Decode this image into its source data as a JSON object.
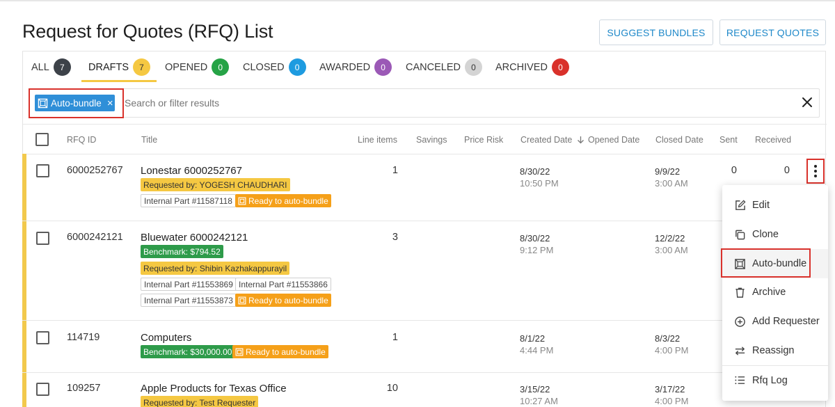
{
  "page": {
    "title": "Request for Quotes (RFQ) List"
  },
  "header": {
    "suggest_label": "SUGGEST BUNDLES",
    "request_label": "REQUEST QUOTES"
  },
  "tabs": [
    {
      "label": "ALL",
      "count": "7",
      "color": "#3d4249"
    },
    {
      "label": "DRAFTS",
      "count": "7",
      "color": "#f5c842"
    },
    {
      "label": "OPENED",
      "count": "0",
      "color": "#26a346"
    },
    {
      "label": "CLOSED",
      "count": "0",
      "color": "#1e9be0"
    },
    {
      "label": "AWARDED",
      "count": "0",
      "color": "#9b59b6"
    },
    {
      "label": "CANCELED",
      "count": "0",
      "color": "#cfcfcf"
    },
    {
      "label": "ARCHIVED",
      "count": "0",
      "color": "#d9312b"
    }
  ],
  "filter": {
    "chip_label": "Auto-bundle",
    "chip_remove": "×",
    "placeholder": "Search or filter results"
  },
  "columns": {
    "rfq_id": "RFQ ID",
    "title": "Title",
    "line_items": "Line items",
    "savings": "Savings",
    "price_risk": "Price Risk",
    "created": "Created Date",
    "opened": "Opened Date",
    "closed": "Closed Date",
    "sent": "Sent",
    "received": "Received"
  },
  "rows": [
    {
      "id": "6000252767",
      "title": "Lonestar 6000252767",
      "line_items": "1",
      "created_date": "8/30/22",
      "created_time": "10:50 PM",
      "closed_date": "9/9/22",
      "closed_time": "3:00 AM",
      "sent": "0",
      "received": "0",
      "requested_by": "Requested by: YOGESH CHAUDHARI",
      "parts": [
        "Internal Part #11587118"
      ],
      "ready": "Ready to auto-bundle"
    },
    {
      "id": "6000242121",
      "title": "Bluewater 6000242121",
      "line_items": "3",
      "created_date": "8/30/22",
      "created_time": "9:12 PM",
      "closed_date": "12/2/22",
      "closed_time": "3:00 AM",
      "benchmark": "Benchmark: $794.52",
      "requested_by": "Requested by: Shibin Kazhakappurayil",
      "parts": [
        "Internal Part #11553869",
        "Internal Part #11553866",
        "Internal Part #11553873"
      ],
      "ready": "Ready to auto-bundle"
    },
    {
      "id": "114719",
      "title": "Computers",
      "line_items": "1",
      "created_date": "8/1/22",
      "created_time": "4:44 PM",
      "closed_date": "8/3/22",
      "closed_time": "4:00 PM",
      "benchmark": "Benchmark: $30,000.00",
      "ready": "Ready to auto-bundle"
    },
    {
      "id": "109257",
      "title": "Apple Products for Texas Office",
      "line_items": "10",
      "created_date": "3/15/22",
      "created_time": "10:27 AM",
      "closed_date": "3/17/22",
      "closed_time": "4:00 PM",
      "requested_by": "Requested by: Test Requester"
    }
  ],
  "menu": {
    "items": [
      "Edit",
      "Clone",
      "Auto-bundle",
      "Archive",
      "Add Requester",
      "Reassign",
      "Rfq Log"
    ]
  }
}
